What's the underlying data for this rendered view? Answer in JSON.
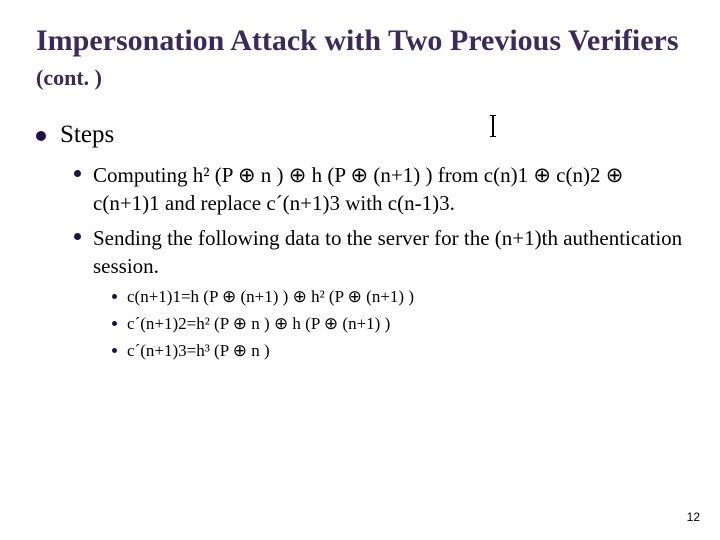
{
  "title_main": "Impersonation Attack with Two Previous Verifiers ",
  "title_cont": "(cont. )",
  "steps_label": "Steps",
  "step1": "Computing  h² (P ⊕ n ) ⊕ h (P ⊕ (n+1) ) from c(n)1 ⊕ c(n)2 ⊕ c(n+1)1 and replace c´(n+1)3 with c(n-1)3.",
  "step2": "Sending the following data to the server for the (n+1)th authentication session.",
  "eq1": "c(n+1)1=h  (P ⊕ (n+1) ) ⊕ h² (P ⊕ (n+1) )",
  "eq2": "c´(n+1)2=h² (P ⊕ n ) ⊕ h (P ⊕ (n+1) )",
  "eq3": "c´(n+1)3=h³ (P ⊕ n )",
  "page_number": "12"
}
